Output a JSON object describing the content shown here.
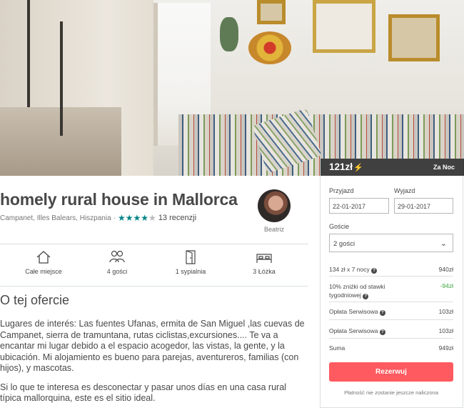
{
  "listing": {
    "title": "homely rural house in Mallorca",
    "location": "Campanet, Illes Balears, Hiszpania",
    "separator": "·",
    "rating_stars": 4,
    "rating_max": 5,
    "review_count_label": "13 recenzji",
    "host_name": "Beatriz"
  },
  "amenities": [
    {
      "icon": "house-icon",
      "label": "Całe miejsce"
    },
    {
      "icon": "guests-icon",
      "label": "4 gości"
    },
    {
      "icon": "door-icon",
      "label": "1 sypialnia"
    },
    {
      "icon": "bed-icon",
      "label": "3 Łóżka"
    }
  ],
  "about": {
    "heading": "O tej ofercie",
    "paragraph1": "Lugares de interés: Las fuentes Ufanas, ermita de San Miguel ,las cuevas de Campanet, sierra de tramuntana, rutas ciclistas,excursiones.... Te va a encantar mi lugar debido a el espacio acogedor, las vistas, la gente, y la ubicación. Mi alojamiento es bueno para parejas, aventureros, familias (con hijos), y mascotas.",
    "paragraph2": "Si lo que te interesa es desconectar y pasar unos días en una casa rural típica mallorquina, este es el sitio ideal."
  },
  "booking": {
    "price": "121zł",
    "per_label": "Za Noc",
    "checkin_label": "Przyjazd",
    "checkin_value": "22-01-2017",
    "checkout_label": "Wyjazd",
    "checkout_value": "29-01-2017",
    "guests_label": "Goście",
    "guests_value": "2 gości",
    "rows": [
      {
        "label": "134 zł x 7 nocy",
        "value": "940zł"
      },
      {
        "label": "10% zniżki od stawki tygodniowej",
        "value": "-94zł"
      },
      {
        "label": "Opłata Serwisowa",
        "value": "103zł"
      },
      {
        "label": "Opłata Serwisowa",
        "value": "103zł"
      },
      {
        "label": "Suma",
        "value": "949zł"
      }
    ],
    "button_label": "Rezerwuj",
    "note": "Płatność nie zostanie jeszcze naliczona"
  },
  "colors": {
    "accent": "#ff5a5f",
    "teal": "#008489",
    "discount": "#3fa644"
  }
}
